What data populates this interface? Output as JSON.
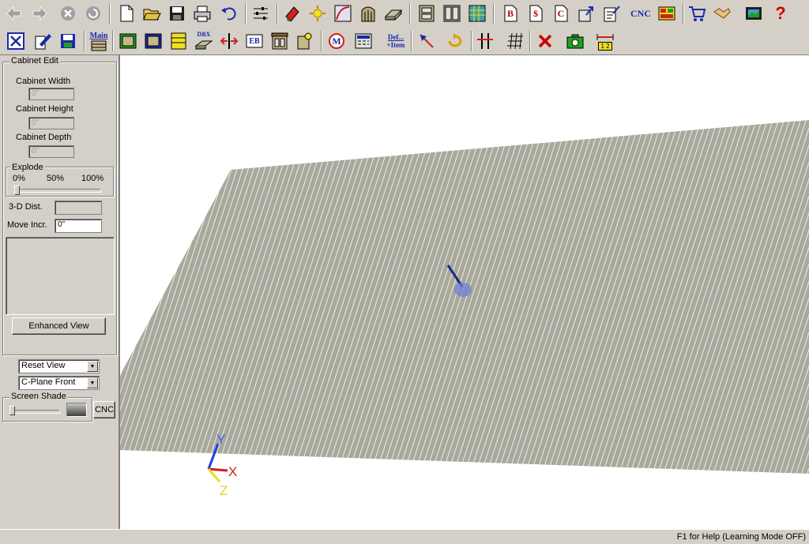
{
  "toolbar1": {
    "icons": [
      "back-arrow-icon",
      "forward-arrow-icon",
      "stop-icon",
      "refresh-icon",
      "new-file-icon",
      "open-folder-icon",
      "save-disk-icon",
      "print-icon",
      "undo-icon",
      "settings-sliders-icon",
      "paint-tool-icon",
      "light-icon",
      "curve-icon",
      "door-icon",
      "panel-icon",
      "cabinet-icon",
      "cabinet-double-icon",
      "pattern-icon",
      "report-b-icon",
      "price-icon",
      "report-c-icon",
      "export-icon",
      "order-icon",
      "cnc-icon",
      "layout-icon",
      "cart-icon",
      "handshake-icon",
      "film-icon",
      "help-icon"
    ],
    "cnc_label": "CNC",
    "b_label": "B",
    "dollar_label": "$",
    "c_label": "C",
    "help_label": "?"
  },
  "toolbar2": {
    "main_label": "Main",
    "dbx_label": "DBX",
    "eb_label": "EB",
    "m_label": "M",
    "def_label": "Def...",
    "item_label": "+Item",
    "scale_label": "1 2"
  },
  "panel": {
    "cabinet_edit": "Cabinet Edit",
    "width_label": "Cabinet Width",
    "width_value": "0\"",
    "height_label": "Cabinet Height",
    "height_value": "0\"",
    "depth_label": "Cabinet Depth",
    "depth_value": "0\"",
    "explode": "Explode",
    "ex0": "0%",
    "ex50": "50%",
    "ex100": "100%",
    "dist_label": "3-D Dist.",
    "dist_value": "",
    "move_label": "Move Incr.",
    "move_value": "0\"",
    "enhanced_view": "Enhanced View",
    "reset_view": "Reset View",
    "cplane": "C-Plane Front",
    "screen_shade": "Screen Shade",
    "cnc": "CNC"
  },
  "view": {
    "axis_y": "Y",
    "axis_x": "X",
    "axis_z": "Z",
    "floor_color": "#a8a89c",
    "plank_line_color": "#f0f0ea"
  },
  "status": {
    "help_text": "F1 for Help (Learning Mode OFF)"
  }
}
